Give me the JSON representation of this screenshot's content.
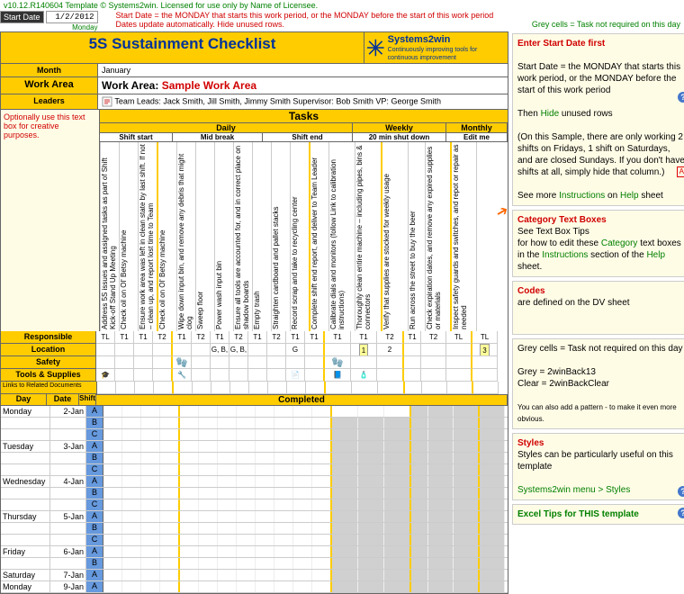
{
  "meta": {
    "version": "v10.12.R140604  Template © Systems2win. Licensed for use only by Name of Licensee.",
    "start_date_label": "Start Date",
    "start_date_value": "1/2/2012",
    "start_date_sub": "Monday",
    "red_note": "Start Date = the MONDAY that starts this work period, or the MONDAY before the start of this work period",
    "auto_note": "Dates update automatically. Hide unused rows.",
    "grey_note": "Grey cells = Task not required on this day"
  },
  "header": {
    "title": "5S Sustainment Checklist",
    "month_label": "Month",
    "month_value": "January",
    "workarea_label": "Work Area",
    "workarea_prefix": "Work Area: ",
    "workarea_value": "Sample Work Area",
    "leaders_label": "Leaders",
    "leaders_value": " Team Leads: Jack Smith, Jill Smith, Jimmy Smith  Supervisor: Bob Smith  VP: George Smith",
    "logo_text": "Systems2win",
    "logo_tag": "Continuously improving tools for continuous improvement",
    "tasks_label": "Tasks",
    "textbox_note": "Optionally use this text box for creative purposes."
  },
  "freq": {
    "daily": "Daily",
    "weekly": "Weekly",
    "monthly": "Monthly",
    "shift_start": "Shift start",
    "mid_break": "Mid break",
    "shift_end": "Shift end",
    "shutdown": "20 min shut down",
    "edit_me": "Edit me"
  },
  "tasks": [
    "Address 5S issues and assigned tasks as part of Shift Kick-off Stand Up Meeting",
    "Check oil on Ol' Betsy machine",
    "Ensure work area was left in clean state by last shift. If not – clean up, and report lost time to Team",
    "Check oil on Ol' Betsy machine",
    "Wipe down input bin, and remove any debris that might clog",
    "Sweep floor",
    "Power wash input bin",
    "Ensure all tools are accounted for, and in correct place on shadow boards",
    "Empty trash",
    "Straighten cardboard and pallet stacks",
    "Record scrap and take to recycling center",
    "Complete shift end report, and deliver to Team Leader",
    "Calibrate dials and monitors (follow Link to calibration instructions)",
    "Thoroughly clean entire machine – including pipes, bins & connectors",
    "Verify that supplies are stocked for weekly usage",
    "Run across the street to buy the beer",
    "Check expiration dates, and remove any expired supplies or materials",
    "Inspect safety guards and switches, and repot or repair as needed"
  ],
  "row_labels": {
    "responsible": "Responsible",
    "location": "Location",
    "safety": "Safety",
    "tools": "Tools & Supplies",
    "links": "Links to Related Documents",
    "day": "Day",
    "date": "Date",
    "shift": "Shift",
    "completed": "Completed"
  },
  "tl": [
    "TL",
    "T1",
    "T1",
    "T2",
    "T1",
    "T2",
    "T1",
    "T2",
    "T1",
    "T2",
    "T1",
    "T1",
    "T1",
    "T1",
    "T2",
    "T1",
    "T2",
    "TL",
    "TL"
  ],
  "loc": [
    "",
    "",
    "",
    "",
    "",
    "",
    "G, B, P",
    "G, B, P",
    "",
    "",
    "G",
    "",
    "",
    "1",
    "2",
    "",
    "",
    "",
    "3"
  ],
  "days": [
    {
      "name": "Monday",
      "date": "2-Jan",
      "shifts": [
        "A",
        "B",
        "C"
      ]
    },
    {
      "name": "Tuesday",
      "date": "3-Jan",
      "shifts": [
        "A",
        "B",
        "C"
      ]
    },
    {
      "name": "Wednesday",
      "date": "4-Jan",
      "shifts": [
        "A",
        "B",
        "C"
      ]
    },
    {
      "name": "Thursday",
      "date": "5-Jan",
      "shifts": [
        "A",
        "B",
        "C"
      ]
    },
    {
      "name": "Friday",
      "date": "6-Jan",
      "shifts": [
        "A",
        "B"
      ]
    },
    {
      "name": "Saturday",
      "date": "7-Jan",
      "shifts": [
        "A"
      ]
    },
    {
      "name": "Monday",
      "date": "9-Jan",
      "shifts": [
        "A"
      ]
    }
  ],
  "tips": {
    "t1_title": "Enter Start Date first",
    "t1_l1": "Start Date = the MONDAY that starts this work period, or the MONDAY before the start of this work period",
    "t1_l2a": "Then ",
    "t1_l2b": "Hide",
    "t1_l2c": " unused rows",
    "t1_l3": "(On this Sample, there are only working 2 shifts on Fridays, 1 shift on Saturdays, and are closed Sundays. If you don't have shifts at all, simply hide that column.)",
    "t1_l4a": "See more ",
    "t1_l4b": "Instructions",
    "t1_l4c": " on ",
    "t1_l4d": "Help",
    "t1_l4e": " sheet",
    "t2_title": "Category Text Boxes",
    "t2_l1": "See Text Box Tips",
    "t2_l2a": "for how to edit these ",
    "t2_l2b": "Category",
    "t2_l2c": " text boxes in the ",
    "t2_l2d": "Instructions",
    "t2_l2e": " section of the ",
    "t2_l2f": "Help",
    "t2_l2g": " sheet.",
    "t3_title": "Codes",
    "t3_l1": "are defined on the DV sheet",
    "t4_l1": "Grey cells = Task not required on this day",
    "t4_l2": "Grey = 2winBack13",
    "t4_l3": "Clear = 2winBackClear",
    "t4_l4": "You can also add a pattern - to make it even more obvious.",
    "t5_title": "Styles",
    "t5_l1": "Styles can be particularly useful on this template",
    "t5_l2": "Systems2win menu > Styles",
    "t6_title": "Excel Tips for THIS template"
  }
}
